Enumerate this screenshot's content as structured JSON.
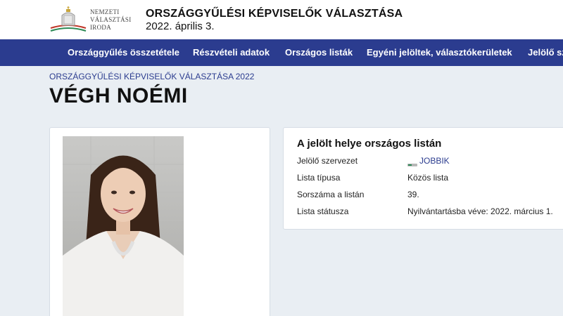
{
  "header": {
    "logo_lines": [
      "NEMZETI",
      "VÁLASZTÁSI",
      "IRODA"
    ],
    "title": "ORSZÁGGYŰLÉSI KÉPVISELŐK VÁLASZTÁSA",
    "date": "2022. április 3."
  },
  "nav": {
    "items": [
      "Országgyűlés összetétele",
      "Részvételi adatok",
      "Országos listák",
      "Egyéni jelöltek, választókerületek",
      "Jelölő szervezetek"
    ]
  },
  "breadcrumb": "ORSZÁGGYŰLÉSI KÉPVISELŐK VÁLASZTÁSA 2022",
  "candidate": {
    "name": "VÉGH NOÉMI"
  },
  "list_card": {
    "title": "A jelölt helye országos listán",
    "rows": [
      {
        "label": "Jelölő szervezet",
        "value": "JOBBIK"
      },
      {
        "label": "Lista típusa",
        "value": "Közös lista"
      },
      {
        "label": "Sorszáma a listán",
        "value": "39."
      },
      {
        "label": "Lista státusza",
        "value": "Nyilvántartásba véve: 2022. március 1."
      }
    ]
  },
  "colors": {
    "nav_bg": "#2b3c8f",
    "page_bg": "#e9eef3",
    "link": "#2b3c8f"
  }
}
